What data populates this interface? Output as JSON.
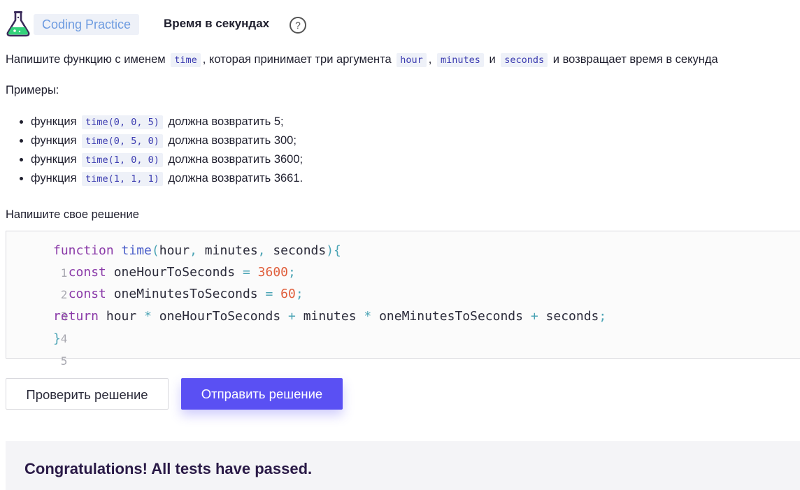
{
  "header": {
    "badge": "Coding Practice",
    "title": "Время в секундах",
    "help": "?"
  },
  "description": {
    "part1": "Напишите функцию с именем",
    "fn_name": "time",
    "part2": ", которая принимает три аргумента",
    "arg1": "hour",
    "sep": ",",
    "arg2": "minutes",
    "and": "и",
    "arg3": "seconds",
    "part3": "и возвращает время в секунда"
  },
  "examples_label": "Примеры:",
  "examples": [
    {
      "prefix": "функция",
      "code": "time(0, 0, 5)",
      "suffix": "должна возвратить 5;"
    },
    {
      "prefix": "функция",
      "code": "time(0, 5, 0)",
      "suffix": "должна возвратить 300;"
    },
    {
      "prefix": "функция",
      "code": "time(1, 0, 0)",
      "suffix": "должна возвратить 3600;"
    },
    {
      "prefix": "функция",
      "code": "time(1, 1, 1)",
      "suffix": "должна возвратить 3661."
    }
  ],
  "solution_label": "Напишите свое решение",
  "editor": {
    "line_numbers": [
      "1",
      "2",
      "3",
      "4",
      "5"
    ],
    "lines": [
      "function time(hour, minutes, seconds){",
      "  const oneHourToSeconds = 3600;",
      "  const oneMinutesToSeconds = 60;",
      "return hour * oneHourToSeconds + minutes * oneMinutesToSeconds + seconds;",
      "}"
    ]
  },
  "buttons": {
    "check": "Проверить решение",
    "submit": "Отправить решение"
  },
  "result": "Congratulations! All tests have passed.",
  "colors": {
    "accent": "#5a50f3",
    "badge_text": "#6d9be0",
    "result_text": "#2a1a47"
  }
}
